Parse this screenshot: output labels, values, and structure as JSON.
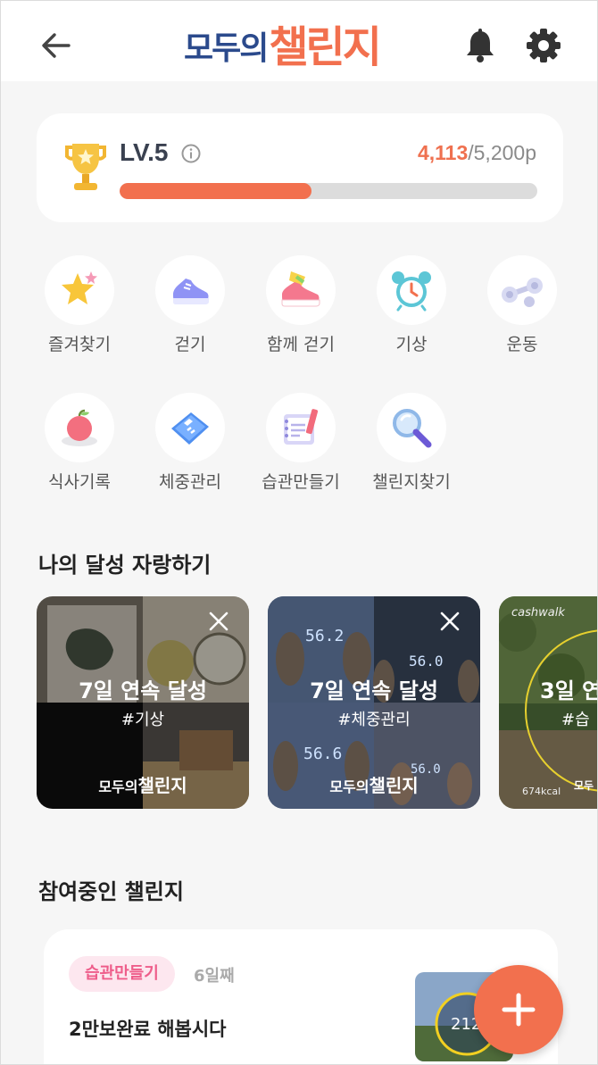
{
  "header": {
    "logo_part1": "모두의",
    "logo_part2": "챌린지"
  },
  "level": {
    "label": "LV.5",
    "current": "4,113",
    "total": "/5,200p",
    "progress": 0.46
  },
  "categories": [
    {
      "label": "즐겨찾기",
      "icon": "star-icon"
    },
    {
      "label": "걷기",
      "icon": "shoe-icon"
    },
    {
      "label": "함께 걷기",
      "icon": "running-shoe-icon"
    },
    {
      "label": "기상",
      "icon": "alarm-clock-icon"
    },
    {
      "label": "운동",
      "icon": "dumbbell-icon"
    },
    {
      "label": "식사기록",
      "icon": "apple-icon"
    },
    {
      "label": "체중관리",
      "icon": "scale-icon"
    },
    {
      "label": "습관만들기",
      "icon": "notebook-icon"
    },
    {
      "label": "챌린지찾기",
      "icon": "magnifier-icon"
    }
  ],
  "achievements": {
    "title": "나의 달성 자랑하기",
    "cards": [
      {
        "title": "7일 연속 달성",
        "tag": "#기상",
        "brand1": "모두의",
        "brand2": "챌린지"
      },
      {
        "title": "7일 연속 달성",
        "tag": "#체중관리",
        "brand1": "모두의",
        "brand2": "챌린지",
        "scale1": "56.2",
        "scale2": "56.0",
        "scale3": "56.6",
        "scale4": "56.0"
      },
      {
        "title": "3일 연",
        "tag": "#습",
        "brand": "cashwalk",
        "kcal": "674kcal",
        "brand1": "모두"
      }
    ]
  },
  "participating": {
    "title": "참여중인 챌린지",
    "card": {
      "tag": "습관만들기",
      "days": "6일째",
      "title": "2만보완료 해봅시다",
      "thumb_num": "212"
    }
  },
  "colors": {
    "accent": "#f2704e",
    "navy": "#2b4a8c",
    "tag_pink": "#ee5d8a"
  }
}
